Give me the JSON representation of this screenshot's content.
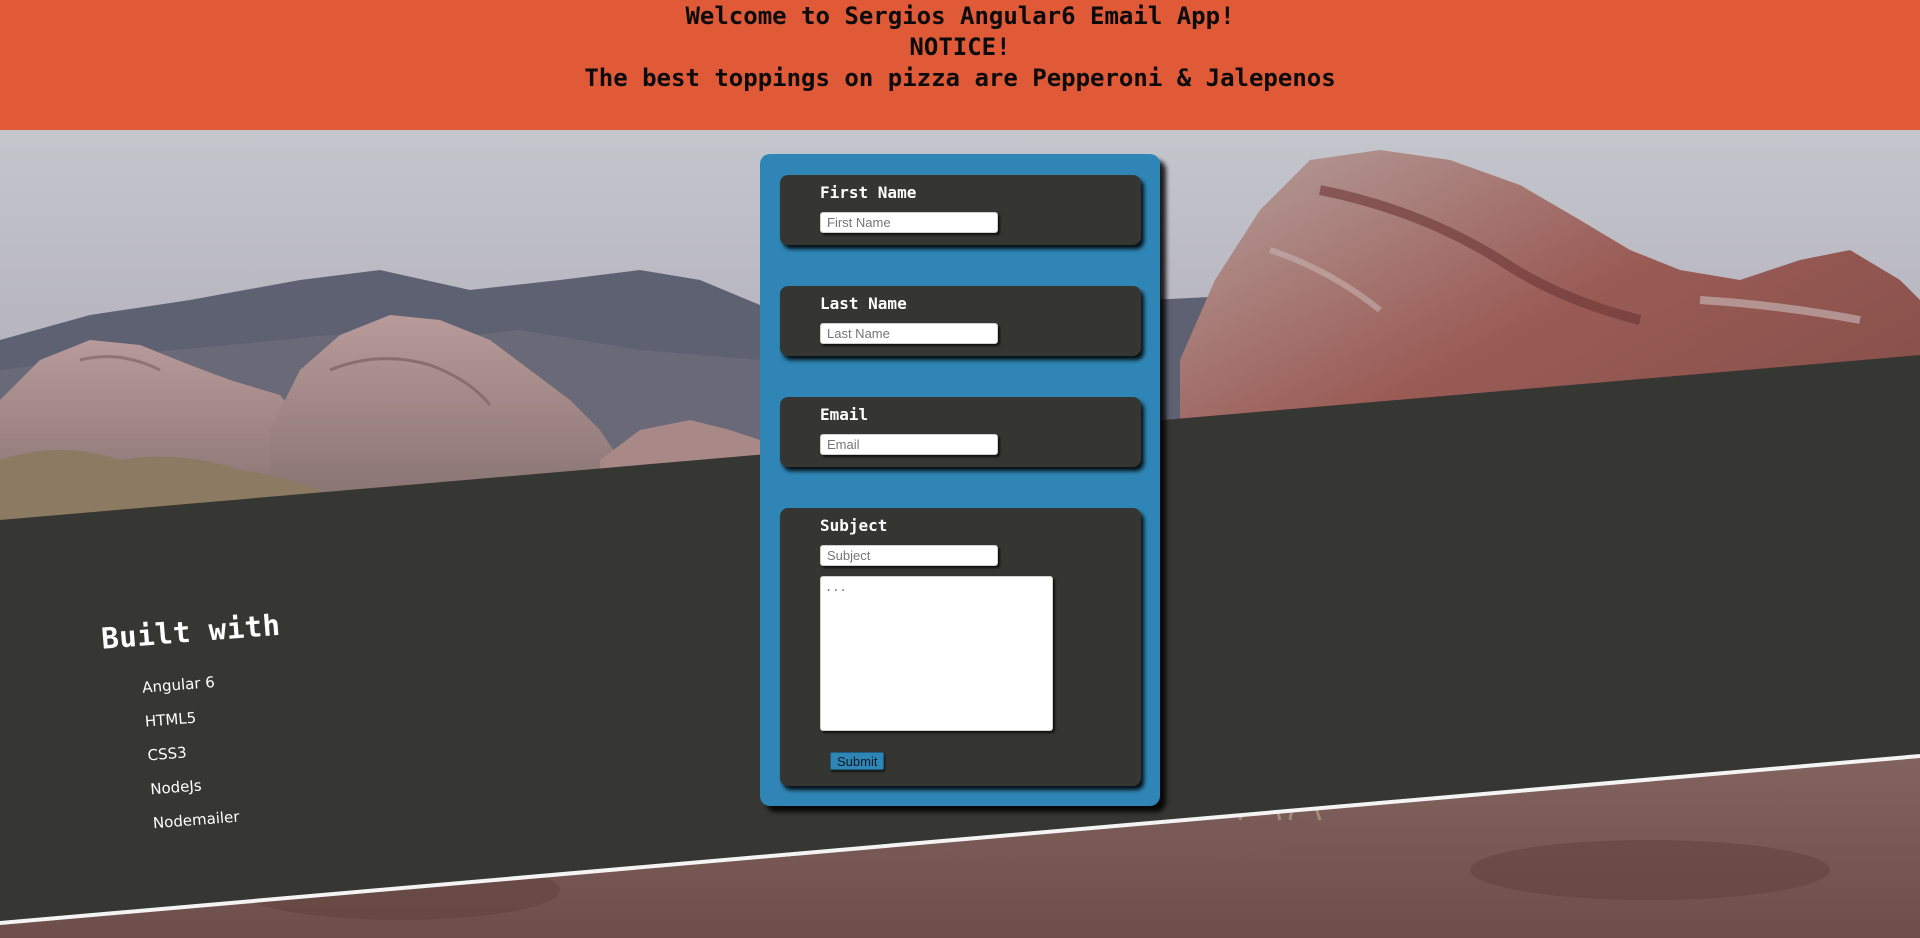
{
  "header": {
    "title": "Welcome to Sergios Angular6 Email App!",
    "notice": "NOTICE!",
    "message": "The best toppings on pizza are Pepperoni & Jalepenos"
  },
  "built_with": {
    "title": "Built with",
    "items": [
      "Angular 6",
      "HTML5",
      "CSS3",
      "NodeJs",
      "Nodemailer"
    ]
  },
  "form": {
    "first_name": {
      "label": "First Name",
      "placeholder": "First Name"
    },
    "last_name": {
      "label": "Last Name",
      "placeholder": "Last Name"
    },
    "email": {
      "label": "Email",
      "placeholder": "Email"
    },
    "subject": {
      "label": "Subject",
      "placeholder": "Subject"
    },
    "message": {
      "placeholder": "..."
    },
    "submit_label": "Submit"
  },
  "colors": {
    "banner": "#e05a38",
    "card": "#2f86b6",
    "panel": "#353531",
    "slanted_band": "#363632"
  }
}
